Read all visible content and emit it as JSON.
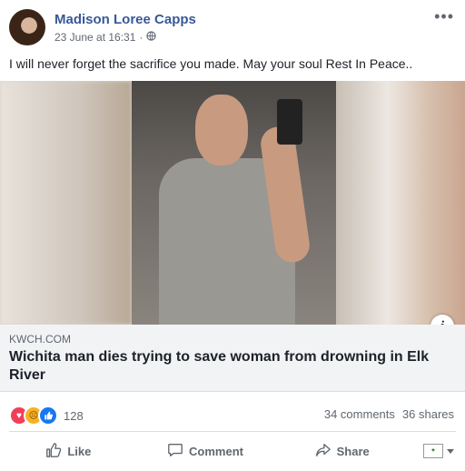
{
  "post": {
    "author": "Madison Loree Capps",
    "timestamp": "23 June at 16:31",
    "separator": "·",
    "privacy_icon": "globe-icon",
    "more_icon": "more-options-icon",
    "text": "I will never forget the sacrifice you made. May your soul Rest In Peace.."
  },
  "link": {
    "domain": "KWCH.COM",
    "headline": "Wichita man dies trying to save woman from drowning in Elk River"
  },
  "reactions": {
    "types": [
      "love",
      "sad",
      "like"
    ],
    "count": "128",
    "comments": "34 comments",
    "shares": "36 shares"
  },
  "actions": {
    "like": "Like",
    "comment": "Comment",
    "share": "Share"
  },
  "colors": {
    "author": "#385898",
    "like": "#1877f2",
    "love": "#f33e58",
    "sad": "#f7b125"
  }
}
